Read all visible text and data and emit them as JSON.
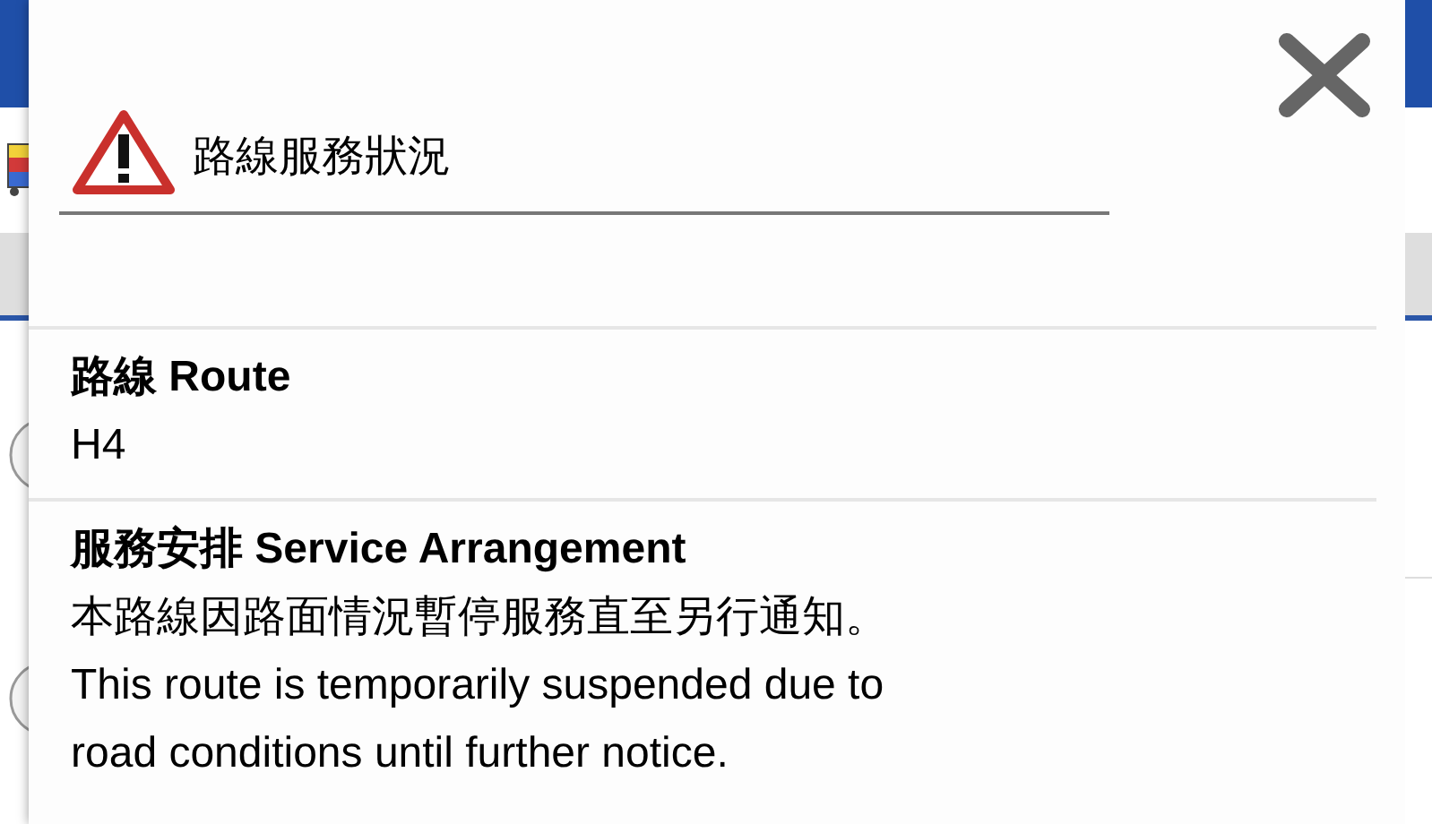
{
  "dialog": {
    "title": "路線服務狀況",
    "sections": [
      {
        "heading": "路線 Route",
        "lines": [
          "H4"
        ]
      },
      {
        "heading": "服務安排 Service Arrangement",
        "lines": [
          "本路線因路面情況暫停服務直至另行通知。",
          "This route is temporarily suspended due to",
          "road conditions until further notice."
        ]
      }
    ]
  }
}
